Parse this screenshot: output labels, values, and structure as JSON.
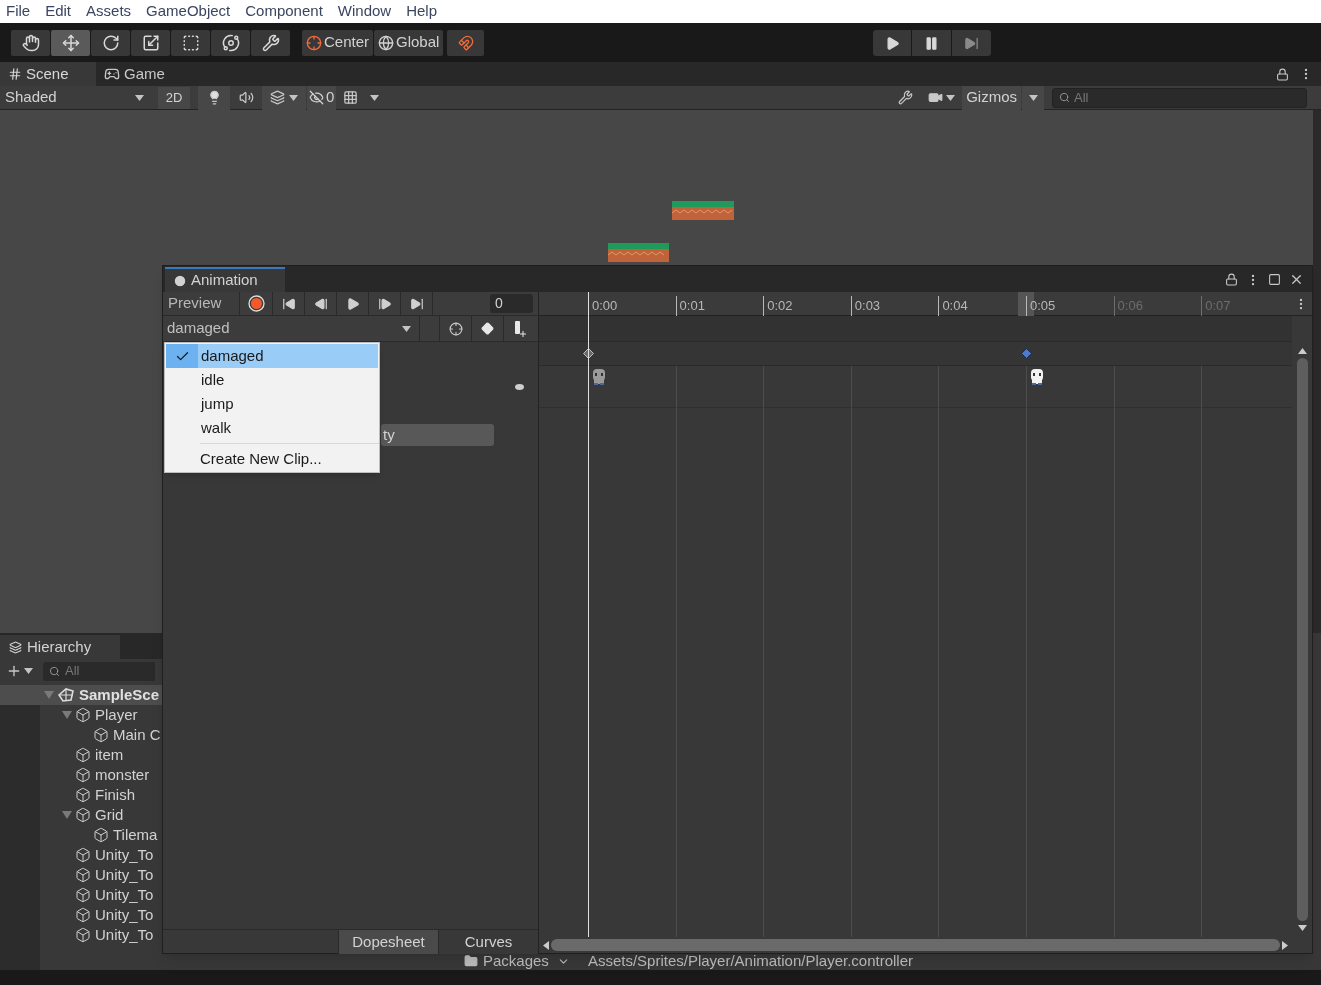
{
  "menu_bar": [
    "File",
    "Edit",
    "Assets",
    "GameObject",
    "Component",
    "Window",
    "Help"
  ],
  "toolbar": {
    "tools": [
      {
        "kind": "hand",
        "selected": false
      },
      {
        "kind": "move",
        "selected": true
      },
      {
        "kind": "rotate",
        "selected": false
      },
      {
        "kind": "scale",
        "selected": false
      },
      {
        "kind": "rect",
        "selected": false
      },
      {
        "kind": "transform",
        "selected": false
      },
      {
        "kind": "custom",
        "selected": false
      }
    ],
    "pivot_buttons": [
      {
        "kind": "pivot",
        "label": "Center"
      },
      {
        "kind": "space",
        "label": "Global"
      }
    ]
  },
  "scene_tabs": [
    {
      "label": "Scene",
      "kind": "scene",
      "selected": true
    },
    {
      "label": "Game",
      "kind": "game",
      "selected": false
    }
  ],
  "scene_toolbar": {
    "draw_mode": "Shaded",
    "mode_2d": "2D",
    "hidden_count": "0",
    "gizmos": "Gizmos",
    "search_placeholder": "All"
  },
  "hierarchy": {
    "tab": "Hierarchy",
    "search_placeholder": "All",
    "tree": [
      {
        "name": "SampleSce",
        "kind": "scene",
        "expanded": true,
        "children": [
          {
            "name": "Player",
            "expanded": true,
            "children": [
              {
                "name": "Main C"
              }
            ]
          },
          {
            "name": "item"
          },
          {
            "name": "monster"
          },
          {
            "name": "Finish"
          },
          {
            "name": "Grid",
            "expanded": true,
            "children": [
              {
                "name": "Tilema"
              }
            ]
          },
          {
            "name": "Unity_To"
          },
          {
            "name": "Unity_To"
          },
          {
            "name": "Unity_To"
          },
          {
            "name": "Unity_To"
          },
          {
            "name": "Unity_To"
          }
        ]
      }
    ]
  },
  "project": {
    "folder": "Packages",
    "path": "Assets/Sprites/Player/Animation/Player.controller"
  },
  "animation": {
    "title": "Animation",
    "preview": "Preview",
    "frame": "0",
    "clip": "damaged",
    "clip_menu": [
      {
        "label": "damaged",
        "selected": true
      },
      {
        "label": "idle",
        "selected": false
      },
      {
        "label": "jump",
        "selected": false
      },
      {
        "label": "walk",
        "selected": false
      }
    ],
    "create_clip": "Create New Clip...",
    "add_property": "ty",
    "ruler": [
      {
        "label": "0:00",
        "dim": false,
        "highlighted": false,
        "keyframe": {
          "selected": false
        }
      },
      {
        "label": "0:01",
        "dim": false,
        "highlighted": false
      },
      {
        "label": "0:02",
        "dim": false,
        "highlighted": false
      },
      {
        "label": "0:03",
        "dim": false,
        "highlighted": false
      },
      {
        "label": "0:04",
        "dim": false,
        "highlighted": false
      },
      {
        "label": "0:05",
        "dim": false,
        "highlighted": true,
        "keyframe": {
          "selected": true
        }
      },
      {
        "label": "0:06",
        "dim": true,
        "highlighted": false
      },
      {
        "label": "0:07",
        "dim": true,
        "highlighted": false
      }
    ],
    "view_tabs": [
      {
        "label": "Dopesheet",
        "selected": true
      },
      {
        "label": "Curves",
        "selected": false
      }
    ]
  }
}
